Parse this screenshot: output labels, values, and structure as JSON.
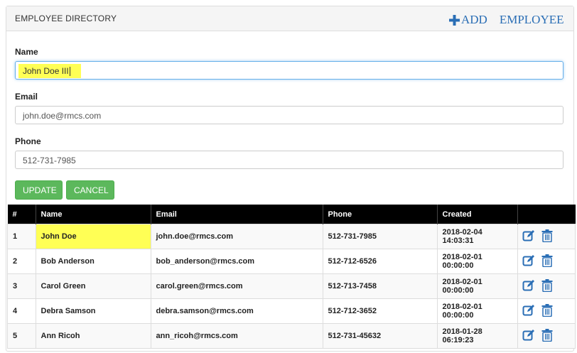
{
  "header": {
    "title": "EMPLOYEE DIRECTORY",
    "add_label": "ADD",
    "add_label_2": "EMPLOYEE"
  },
  "form": {
    "name_label": "Name",
    "name_value": "John Doe III",
    "email_label": "Email",
    "email_value": "john.doe@rmcs.com",
    "phone_label": "Phone",
    "phone_value": "512-731-7985",
    "update_label": "UPDATE",
    "cancel_label": "CANCEL"
  },
  "table": {
    "headers": [
      "#",
      "Name",
      "Email",
      "Phone",
      "Created",
      ""
    ],
    "rows": [
      {
        "id": "1",
        "name": "John Doe",
        "email": "john.doe@rmcs.com",
        "phone": "512-731-7985",
        "created": "2018-02-04 14:03:31"
      },
      {
        "id": "2",
        "name": "Bob Anderson",
        "email": "bob_anderson@rmcs.com",
        "phone": "512-712-6526",
        "created": "2018-02-01 00:00:00"
      },
      {
        "id": "3",
        "name": "Carol Green",
        "email": "carol.green@rmcs.com",
        "phone": "512-713-7458",
        "created": "2018-02-01 00:00:00"
      },
      {
        "id": "4",
        "name": "Debra Samson",
        "email": "debra.samson@rmcs.com",
        "phone": "512-712-3652",
        "created": "2018-02-01 00:00:00"
      },
      {
        "id": "5",
        "name": "Ann Ricoh",
        "email": "ann_ricoh@rmcs.com",
        "phone": "512-731-45632",
        "created": "2018-01-28 06:19:23"
      }
    ]
  },
  "colors": {
    "accent": "#2a6eb5",
    "button_green": "#5cb85c",
    "highlight": "#ffff55",
    "header_black": "#000000"
  },
  "icons": {
    "add": "plus-icon",
    "edit": "edit-icon",
    "delete": "trash-icon"
  }
}
